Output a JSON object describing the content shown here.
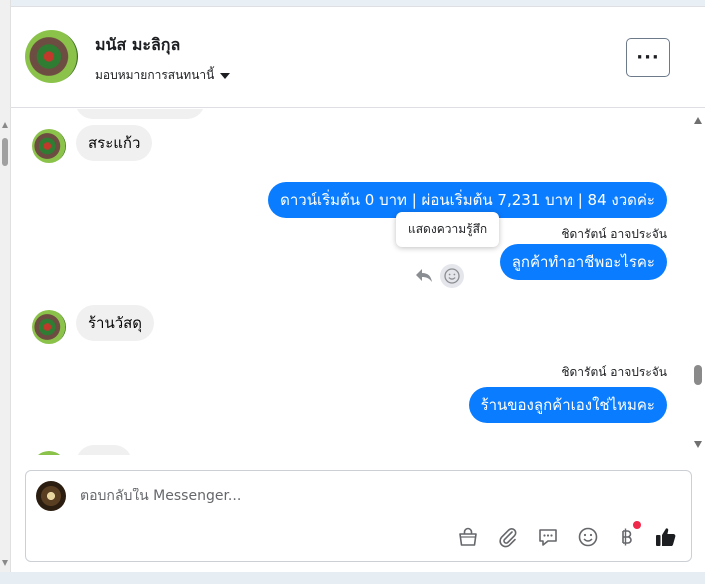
{
  "header": {
    "contact_name": "มนัส มะลิกุล",
    "assign_label": "มอบหมายการสนทนานี้",
    "more_button": "···"
  },
  "messages": [
    {
      "direction": "in",
      "text": "สระแก้ว"
    },
    {
      "direction": "out",
      "text": "ดาวน์เริ่มต้น 0 บาท | ผ่อนเริ่มต้น 7,231 บาท | 84 งวดค่ะ"
    },
    {
      "direction": "out",
      "sender": "ชิดารัตน์ อาจประจัน",
      "text": "ลูกค้าทำอาชีพอะไรคะ"
    },
    {
      "direction": "in",
      "text": "ร้านวัสดุ"
    },
    {
      "direction": "out",
      "sender": "ชิดารัตน์ อาจประจัน",
      "text": "ร้านของลูกค้าเองใช่ไหมคะ"
    }
  ],
  "tooltip": "แสดงความรู้สึก",
  "composer": {
    "placeholder": "ตอบกลับใน Messenger...",
    "tools": [
      "shopping-bag-icon",
      "paperclip-icon",
      "saved-reply-icon",
      "emoji-icon",
      "baht-payment-icon",
      "thumbs-up-icon"
    ]
  },
  "colors": {
    "outgoing_bubble": "#0a7cff",
    "incoming_bubble": "#f0f0f0",
    "notification_dot": "#f02849"
  }
}
